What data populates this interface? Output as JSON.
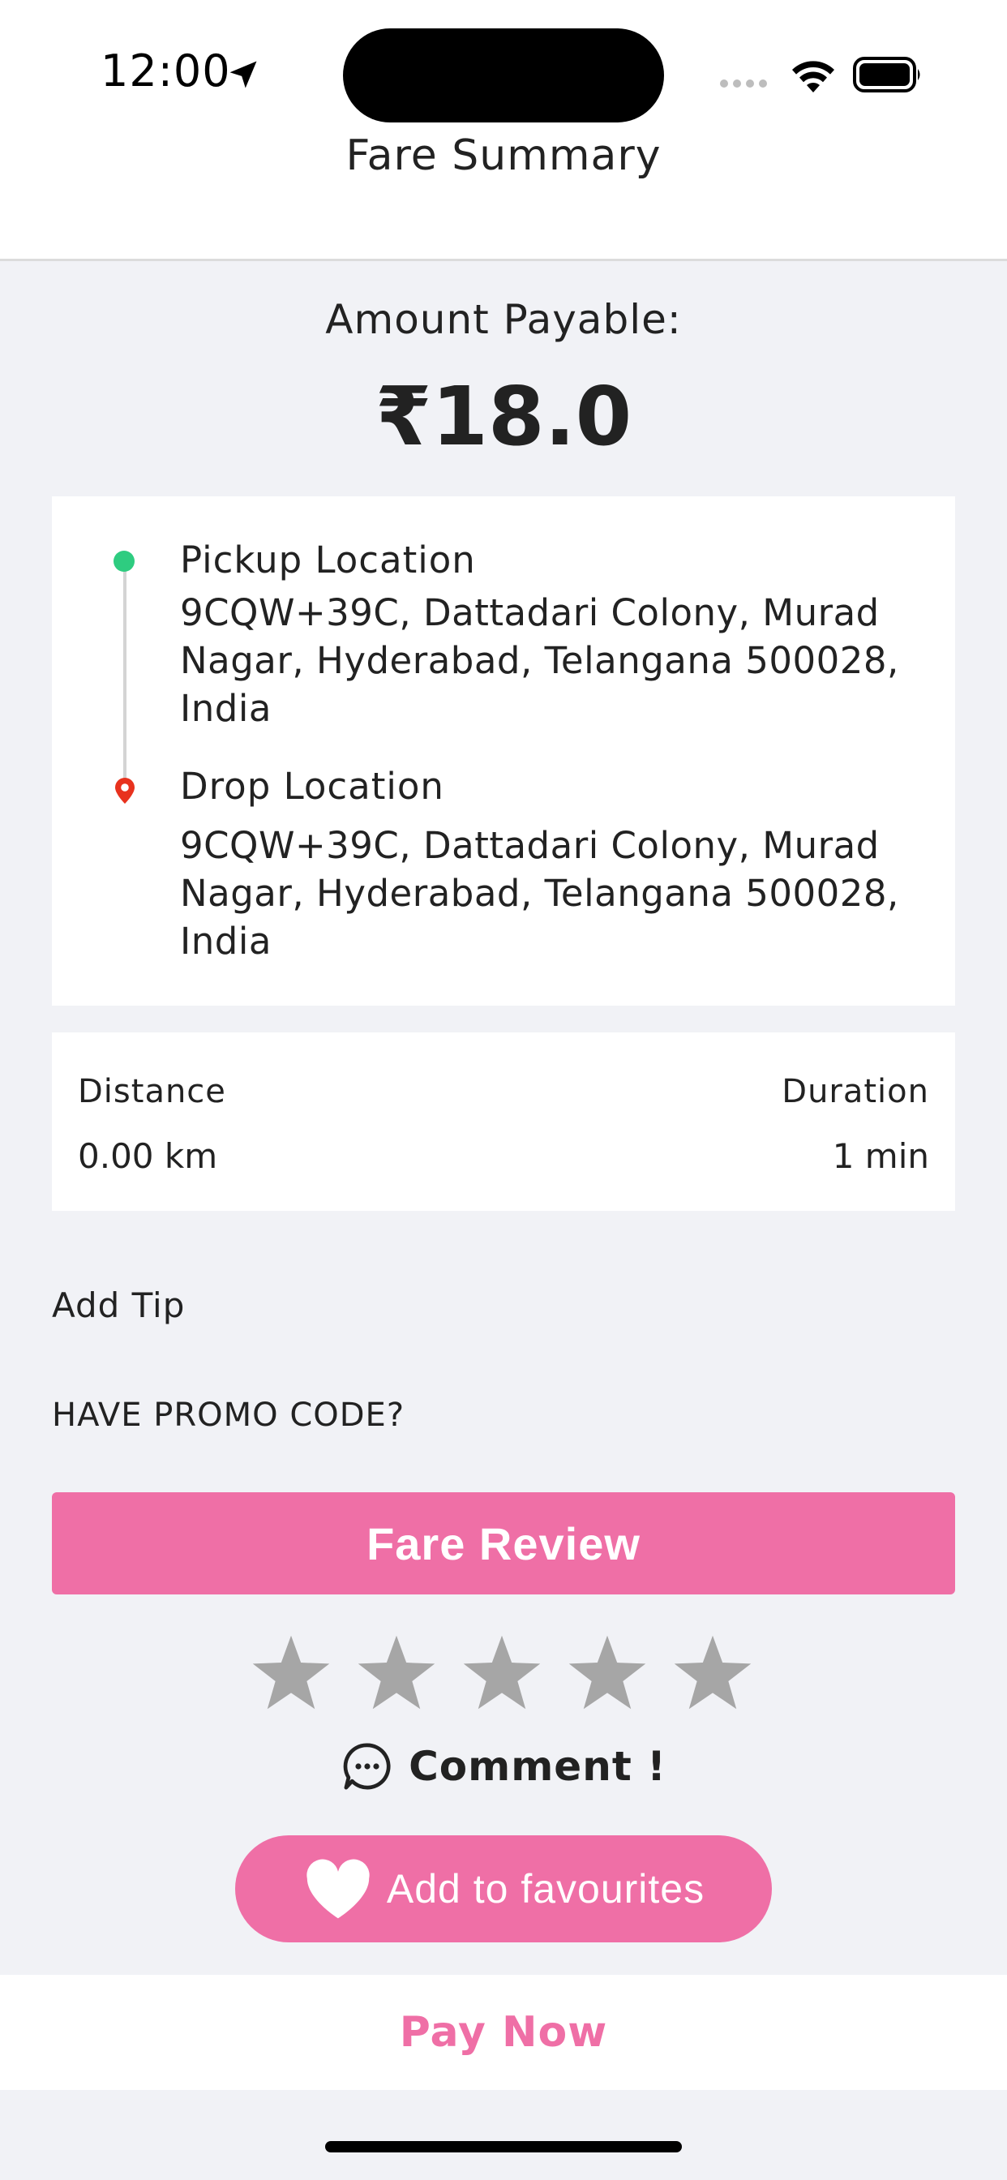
{
  "status_bar": {
    "time": "12:00",
    "icons": [
      "location-arrow-icon",
      "signal-icon",
      "wifi-icon",
      "battery-icon"
    ]
  },
  "header": {
    "title": "Fare Summary"
  },
  "amount": {
    "label": "Amount Payable:",
    "value": "₹18.0"
  },
  "locations": {
    "pickup": {
      "title": "Pickup Location",
      "address": "9CQW+39C, Dattadari Colony, Murad Nagar, Hyderabad, Telangana 500028, India"
    },
    "drop": {
      "title": "Drop Location",
      "address": "9CQW+39C, Dattadari Colony, Murad Nagar, Hyderabad, Telangana 500028, India"
    }
  },
  "trip_stats": {
    "distance_label": "Distance",
    "distance_value": "0.00 km",
    "duration_label": "Duration",
    "duration_value": "1 min"
  },
  "add_tip_label": "Add Tip",
  "promo_label": "HAVE PROMO CODE?",
  "fare_review_label": "Fare Review",
  "rating": {
    "value": 0,
    "max": 5
  },
  "comment_label": "Comment !",
  "favourites_label": "Add to favourites",
  "pay_now_label": "Pay Now",
  "colors": {
    "accent": "#ef6fa6",
    "pickup_dot": "#2ecc80",
    "drop_pin": "#e8321e",
    "star_empty": "#a6a6a6",
    "background": "#f1f2f6"
  }
}
